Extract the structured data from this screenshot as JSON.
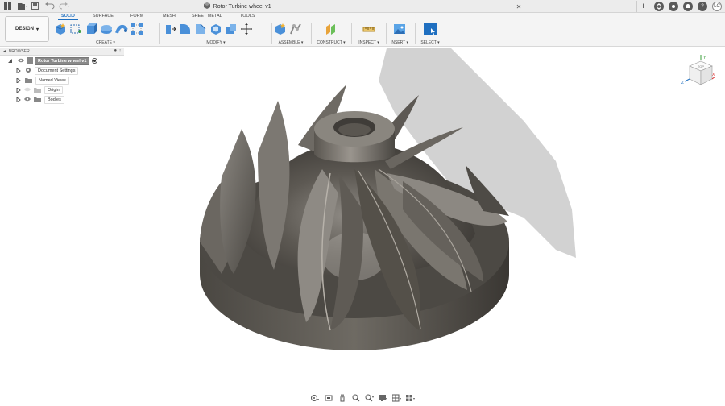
{
  "window": {
    "title": "Rotor Turbine wheel v1",
    "user_initials": "LC"
  },
  "workspace": {
    "label": "DESIGN"
  },
  "tabs": [
    {
      "label": "SOLID",
      "active": true
    },
    {
      "label": "SURFACE",
      "active": false
    },
    {
      "label": "FORM",
      "active": false
    },
    {
      "label": "MESH",
      "active": false
    },
    {
      "label": "SHEET METAL",
      "active": false
    },
    {
      "label": "TOOLS",
      "active": false
    }
  ],
  "groups": {
    "create": "CREATE",
    "modify": "MODIFY",
    "assemble": "ASSEMBLE",
    "construct": "CONSTRUCT",
    "inspect": "INSPECT",
    "insert": "INSERT",
    "select": "SELECT"
  },
  "browser": {
    "title": "BROWSER",
    "items": [
      {
        "label": "Rotor Turbine wheel v1",
        "icon": "document-icon",
        "root": true
      },
      {
        "label": "Document Settings",
        "icon": "gear-icon"
      },
      {
        "label": "Named Views",
        "icon": "folder-icon"
      },
      {
        "label": "Origin",
        "icon": "folder-icon"
      },
      {
        "label": "Bodies",
        "icon": "folder-icon"
      }
    ]
  },
  "viewcube": {
    "face": "TOP",
    "axis_x": "X",
    "axis_y": "Y",
    "axis_z": "Z"
  },
  "colors": {
    "accent": "#1f6fc0",
    "part": "#5f5b55",
    "shadow": "#d0d0d0"
  }
}
